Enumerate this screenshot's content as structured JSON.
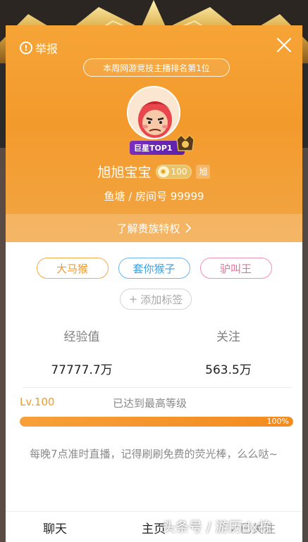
{
  "header": {
    "report_label": "举报",
    "rank_text": "本周网游竞技主播排名第1位",
    "top_badge": "巨星TOP1",
    "name": "旭旭宝宝",
    "level_value": "100",
    "fan_badge": "旭",
    "room_text": "鱼塘 / 房间号  99999",
    "noble_link": "了解贵族特权"
  },
  "tags": [
    {
      "label": "大马猴"
    },
    {
      "label": "套你猴子"
    },
    {
      "label": "驴叫王"
    }
  ],
  "add_tag_label": "添加标签",
  "stats": {
    "exp_label": "经验值",
    "exp_value": "77777.7万",
    "follow_label": "关注",
    "follow_value": "563.5万"
  },
  "level": {
    "label": "Lv.100",
    "desc": "已达到最高等级",
    "progress_percent": 100,
    "progress_label": "100%"
  },
  "bio": "每晚7点准时直播，记得刷刷免费的荧光棒，么么哒~",
  "bottom": {
    "chat_label": "聊天",
    "home_label": "主页",
    "follow_label": "✓已关注"
  },
  "watermark": "头条号 / 游历dx栋",
  "colors": {
    "header_orange": "#f39a2c",
    "accent_orange": "#f29a2a",
    "tag_blue": "#3f9fde",
    "tag_pink": "#e67096"
  }
}
